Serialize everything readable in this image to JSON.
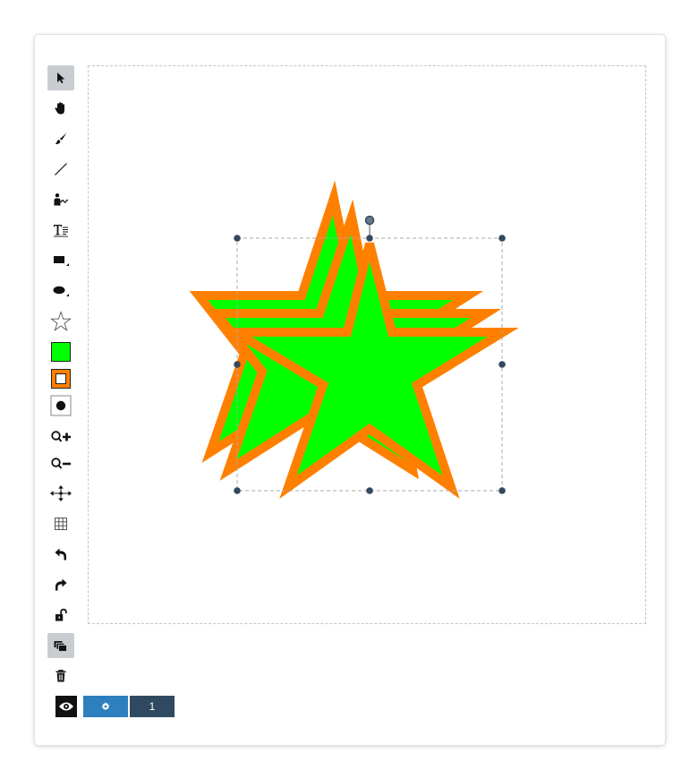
{
  "colors": {
    "fill": "#00ff00",
    "stroke": "#ff8000",
    "handle": "#34495e",
    "active_tool_bg": "#c9ccd1",
    "settings_bg": "#2e7fbd",
    "page_bg": "#2f4a60"
  },
  "toolbar": {
    "tools": [
      {
        "name": "select-tool",
        "icon": "cursor-icon",
        "active": true
      },
      {
        "name": "pan-tool",
        "icon": "hand-icon",
        "active": false
      },
      {
        "name": "brush-tool",
        "icon": "brush-icon",
        "active": false
      },
      {
        "name": "line-tool",
        "icon": "line-icon",
        "active": false
      },
      {
        "name": "signature-tool",
        "icon": "signature-icon",
        "active": false
      },
      {
        "name": "text-tool",
        "icon": "text-icon",
        "active": false
      },
      {
        "name": "rectangle-tool",
        "icon": "rectangle-icon",
        "active": false
      },
      {
        "name": "ellipse-tool",
        "icon": "ellipse-icon",
        "active": false
      },
      {
        "name": "star-tool",
        "icon": "star-icon",
        "active": false
      },
      {
        "name": "fill-color",
        "icon": "fill-color-swatch",
        "active": false
      },
      {
        "name": "stroke-color",
        "icon": "stroke-color-swatch",
        "active": false
      },
      {
        "name": "stroke-width",
        "icon": "stroke-width-icon",
        "active": false
      },
      {
        "name": "zoom-in",
        "icon": "zoom-in-icon",
        "active": false
      },
      {
        "name": "zoom-out",
        "icon": "zoom-out-icon",
        "active": false
      },
      {
        "name": "move-tool",
        "icon": "move-icon",
        "active": false
      },
      {
        "name": "grid-toggle",
        "icon": "grid-icon",
        "active": false
      },
      {
        "name": "undo",
        "icon": "undo-icon",
        "active": false
      },
      {
        "name": "redo",
        "icon": "redo-icon",
        "active": false
      },
      {
        "name": "lock-toggle",
        "icon": "unlock-icon",
        "active": false
      },
      {
        "name": "layers-toggle",
        "icon": "layers-icon",
        "active": true
      },
      {
        "name": "delete",
        "icon": "trash-icon",
        "active": false
      }
    ]
  },
  "bottom_bar": {
    "preview_icon": "eye-icon",
    "settings_icon": "gear-icon",
    "page_label": "1"
  }
}
